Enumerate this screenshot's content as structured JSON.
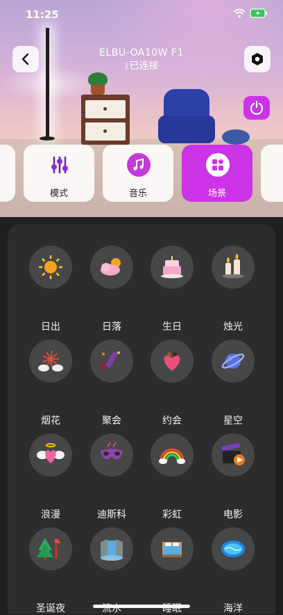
{
  "status": {
    "time": "11:25"
  },
  "header": {
    "title": "ELBU-OA10W  F1",
    "subtitle": "已连接"
  },
  "tabs": [
    {
      "label": "模式",
      "icon": "sliders-icon",
      "active": false
    },
    {
      "label": "音乐",
      "icon": "music-note-icon",
      "active": false
    },
    {
      "label": "场景",
      "icon": "scene-grid-icon",
      "active": true
    }
  ],
  "scenes": [
    {
      "label": "日出",
      "icon": "sun-icon"
    },
    {
      "label": "日落",
      "icon": "sunset-cloud-icon"
    },
    {
      "label": "生日",
      "icon": "cake-icon"
    },
    {
      "label": "烛光",
      "icon": "candle-icon"
    },
    {
      "label": "烟花",
      "icon": "fireworks-icon"
    },
    {
      "label": "聚会",
      "icon": "party-icon"
    },
    {
      "label": "约会",
      "icon": "date-heart-icon"
    },
    {
      "label": "星空",
      "icon": "planet-icon"
    },
    {
      "label": "浪漫",
      "icon": "angel-heart-icon"
    },
    {
      "label": "迪斯科",
      "icon": "disco-mask-icon"
    },
    {
      "label": "彩虹",
      "icon": "rainbow-icon"
    },
    {
      "label": "电影",
      "icon": "movie-clapper-icon"
    },
    {
      "label": "圣诞夜",
      "icon": "christmas-tree-icon"
    },
    {
      "label": "流水",
      "icon": "waterfall-icon"
    },
    {
      "label": "睡眠",
      "icon": "bed-icon"
    },
    {
      "label": "海洋",
      "icon": "ocean-icon"
    }
  ],
  "colors": {
    "accent": "#cd33e6",
    "panel": "#2c2c2c",
    "circle": "#474747"
  }
}
